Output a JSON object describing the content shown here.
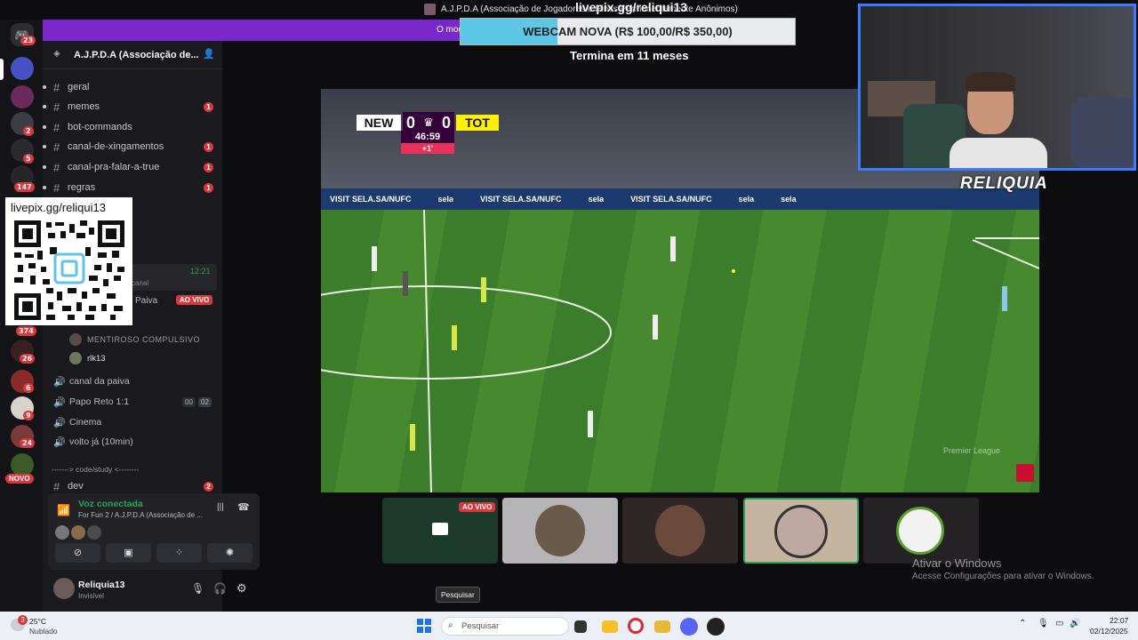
{
  "window_title": "A.J.P.D.A (Associação de Jogadores e Hinos Permanentemente Anônimos)",
  "overlay": {
    "livepix_top": "livepix.gg/reliqui13",
    "goal_label": "WEBCAM NOVA (R$ 100,00/R$ 350,00)",
    "goal_progress": 0.29,
    "ends_in": "Termina em 11 meses",
    "qr_url": "livepix.gg/reliqui13",
    "webcam_logo": "RELIQUIA"
  },
  "purple_bar": {
    "text": "O mod"
  },
  "server_rail": {
    "badges": [
      "23",
      "2",
      "5",
      "147",
      "374",
      "26",
      "6",
      "9",
      "24"
    ],
    "novo_label": "NOVO"
  },
  "server": {
    "name": "A.J.P.D.A (Associação de..."
  },
  "channels": [
    {
      "name": "geral",
      "unread": ""
    },
    {
      "name": "memes",
      "unread": "1"
    },
    {
      "name": "bot-commands",
      "unread": ""
    },
    {
      "name": "canal-de-xingamentos",
      "unread": "1"
    },
    {
      "name": "canal-pra-falar-a-true",
      "unread": "1"
    },
    {
      "name": "regras",
      "unread": "1"
    }
  ],
  "partial": {
    "time": "12:21",
    "canal": "canal",
    "paiva": "Paiva",
    "ao_vivo": "AO VIVO"
  },
  "voice_users": [
    {
      "name": "MENTIROSO COMPULSIVO"
    },
    {
      "name": "rlk13"
    }
  ],
  "voice_channels": [
    {
      "name": "canal da paiva",
      "icon": "speaker-icon"
    },
    {
      "name": "Papo Reto 1:1",
      "count_a": "00",
      "count_b": "02"
    },
    {
      "name": "Cinema"
    },
    {
      "name": "volto já (10min)"
    }
  ],
  "category": "-------> code/study <--------",
  "dev_channel": {
    "name": "dev",
    "unread": "2"
  },
  "voice_panel": {
    "status": "Voz conectada",
    "location": "For Fun 2 / A.J.P.D.A (Associação de ..."
  },
  "user": {
    "name": "Reliquia13",
    "status": "Invisível"
  },
  "scoreboard": {
    "home": "NEW",
    "home_score": "0",
    "away": "TOT",
    "away_score": "0",
    "clock": "46:59",
    "added": "+1'"
  },
  "broadcast_watermark": "Premier League",
  "ad_boards": [
    "VISIT SELA.SA/NUFC",
    "sela",
    "VISIT SELA.SA/NUFC",
    "sela",
    "VISIT SELA.SA/NUFC",
    "sela",
    "sela"
  ],
  "tiles": [
    {
      "label": "AO VIVO"
    },
    {
      "label": ""
    },
    {
      "label": ""
    },
    {
      "label": ""
    },
    {
      "label": ""
    }
  ],
  "tooltip": "Pesquisar",
  "windows_activation": {
    "title": "Ativar o Windows",
    "subtitle": "Acesse Configurações para ativar o Windows."
  },
  "taskbar": {
    "weather_temp": "25°C",
    "weather_desc": "Nublado",
    "weather_badge": "3",
    "search_placeholder": "Pesquisar",
    "time": "22:07",
    "date": "02/12/2025"
  },
  "colors": {
    "accent_purple": "#7a28cb",
    "discord_red": "#da373c",
    "voice_green": "#23a55a",
    "goal_blue": "#5cc6e6",
    "webcam_border": "#3a7bff"
  }
}
